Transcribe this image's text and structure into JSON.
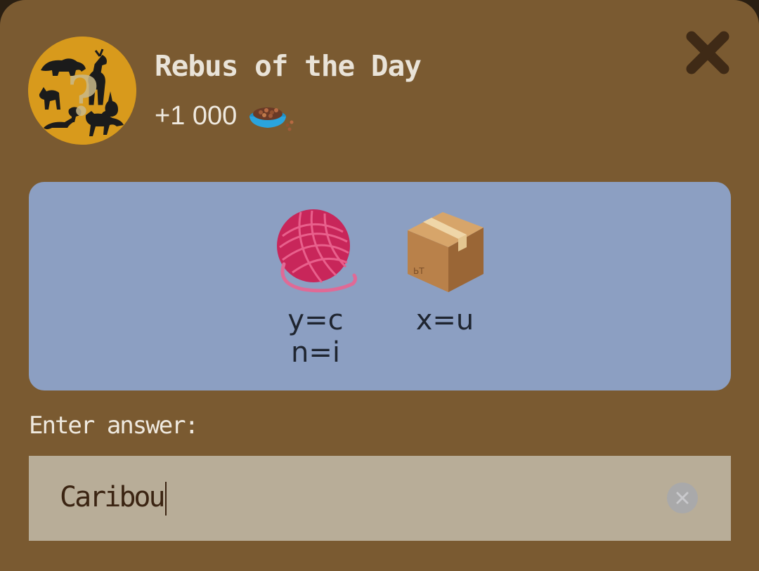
{
  "dialog": {
    "title": "Rebus of the Day",
    "reward_amount": "+1 000",
    "reward_icon": "pet-food-bowl-icon",
    "avatar_icon": "animal-silhouettes-question-icon",
    "close_icon": "close-icon"
  },
  "puzzle": {
    "items": [
      {
        "icon": "yarn-ball-icon",
        "hints": [
          "y=c",
          "n=i"
        ]
      },
      {
        "icon": "cardboard-box-icon",
        "hints": [
          "x=u"
        ]
      }
    ]
  },
  "answer": {
    "prompt": "Enter answer:",
    "value": "Caribou",
    "clear_icon": "clear-icon"
  },
  "colors": {
    "background": "#7a5a31",
    "puzzle_card": "#8c9fc2",
    "input_field": "#b8ad98",
    "avatar": "#d89a1c"
  }
}
